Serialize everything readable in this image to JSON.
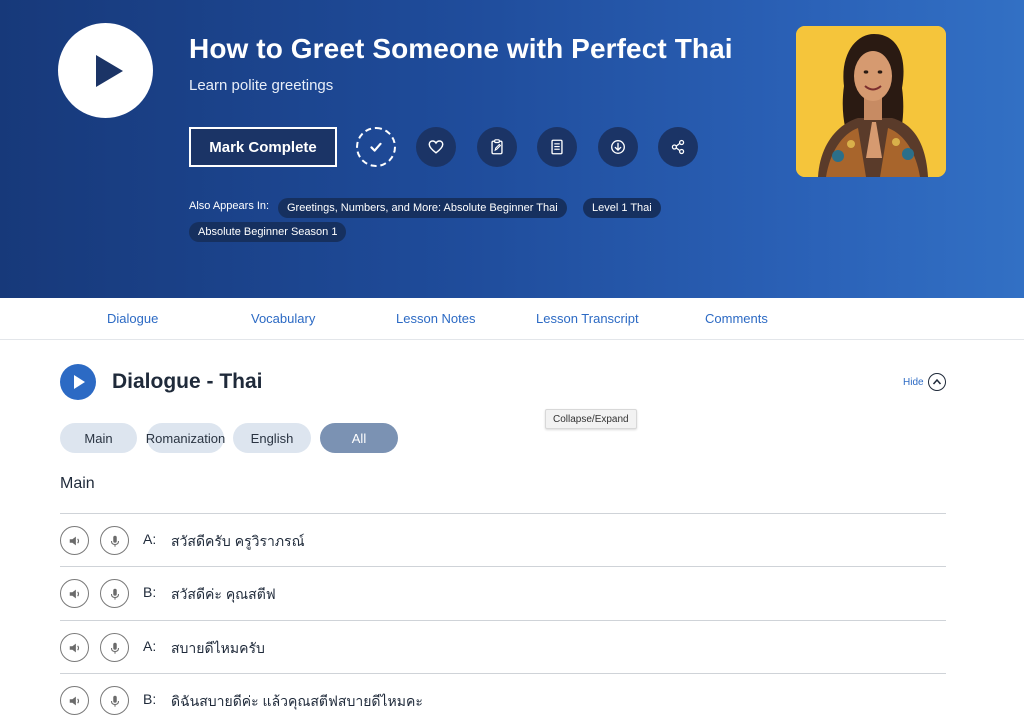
{
  "lesson": {
    "title": "How to Greet Someone with Perfect Thai",
    "subtitle": "Learn polite greetings",
    "mark_complete_label": "Mark Complete",
    "also_appears_label": "Also Appears In:",
    "tags": [
      "Greetings, Numbers, and More: Absolute Beginner Thai",
      "Level 1 Thai",
      "Absolute Beginner Season 1"
    ],
    "action_icons": [
      "check-icon",
      "heart-icon",
      "notes-icon",
      "pdf-icon",
      "download-icon",
      "share-icon"
    ]
  },
  "nav": {
    "items": [
      "Dialogue",
      "Vocabulary",
      "Lesson Notes",
      "Lesson Transcript",
      "Comments"
    ]
  },
  "dialogue": {
    "title": "Dialogue - Thai",
    "hide_label": "Hide",
    "tooltip": "Collapse/Expand",
    "filters": [
      "Main",
      "Romanization",
      "English",
      "All"
    ],
    "active_filter": "All",
    "section_heading": "Main",
    "lines": [
      {
        "speaker": "A:",
        "text": "สวัสดีครับ ครูวิราภรณ์"
      },
      {
        "speaker": "B:",
        "text": "สวัสดีค่ะ คุณสตีฟ"
      },
      {
        "speaker": "A:",
        "text": "สบายดีไหมครับ"
      },
      {
        "speaker": "B:",
        "text": "ดิฉันสบายดีค่ะ แล้วคุณสตีฟสบายดีไหมคะ"
      }
    ]
  },
  "colors": {
    "hero_dark": "#17397a",
    "hero_light": "#3270c4",
    "accent_blue": "#2c6ac4",
    "button_navy": "#1b3466",
    "photo_bg": "#f5c53b",
    "active_pill": "#7b92b3"
  }
}
